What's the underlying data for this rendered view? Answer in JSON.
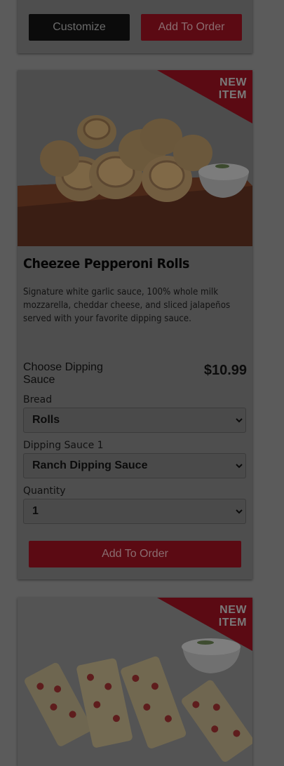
{
  "top_card": {
    "customize_label": "Customize",
    "add_label": "Add To Order"
  },
  "product": {
    "badge_line1": "NEW",
    "badge_line2": "ITEM",
    "title": "Cheezee Pepperoni Rolls",
    "description": "Signature white garlic sauce, 100% whole milk mozzarella, cheddar cheese, and sliced jalapeños served with your favorite dipping sauce.",
    "choose_label": "Choose Dipping Sauce",
    "price": "$10.99",
    "bread_label": "Bread",
    "bread_value": "Rolls",
    "sauce_label": "Dipping Sauce 1",
    "sauce_value": "Ranch Dipping Sauce",
    "quantity_label": "Quantity",
    "quantity_value": "1",
    "add_label": "Add To Order"
  },
  "next_product": {
    "badge_line1": "NEW",
    "badge_line2": "ITEM"
  },
  "colors": {
    "overlay_bg": "#5b5b5b",
    "card_bg": "#4e4e4e",
    "brand_red_dimmed": "#5b0a13"
  }
}
